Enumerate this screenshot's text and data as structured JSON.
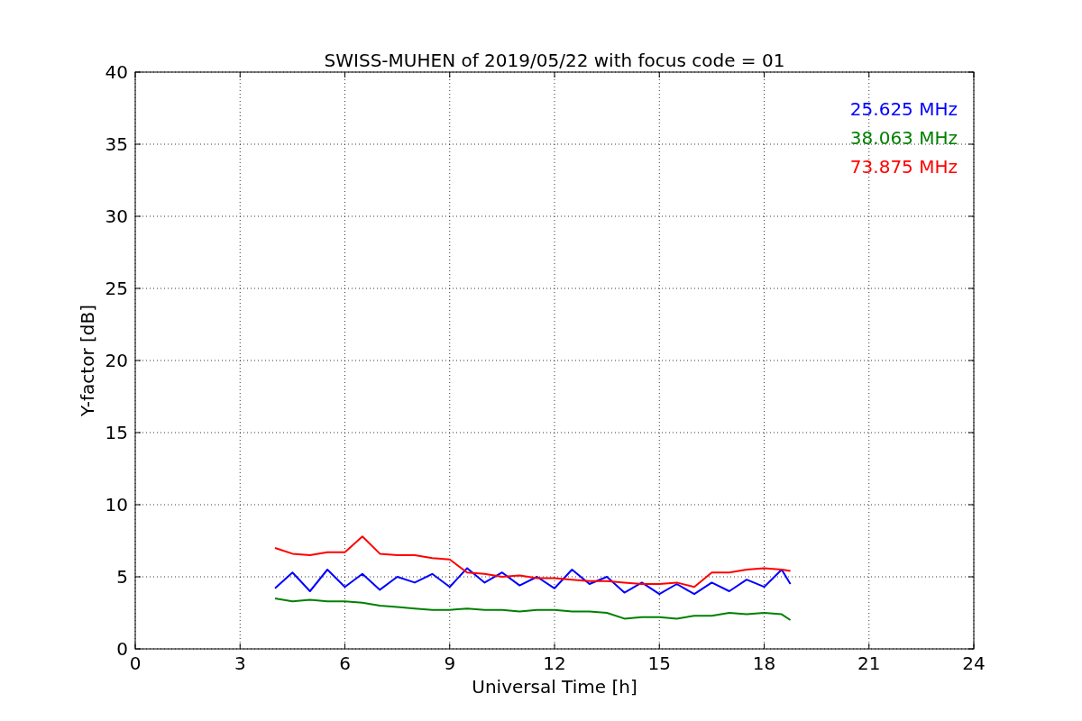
{
  "chart_data": {
    "type": "line",
    "title": "SWISS-MUHEN of 2019/05/22 with focus code = 01",
    "xlabel": "Universal Time [h]",
    "ylabel": "Y-factor [dB]",
    "x": [
      4,
      4.5,
      5,
      5.5,
      6,
      6.5,
      7,
      7.5,
      8,
      8.5,
      9,
      9.5,
      10,
      10.5,
      11,
      11.5,
      12,
      12.5,
      13,
      13.5,
      14,
      14.5,
      15,
      15.5,
      16,
      16.5,
      17,
      17.5,
      18,
      18.5,
      18.75
    ],
    "series": [
      {
        "name": "25.625 MHz",
        "color": "#0000ff",
        "values": [
          4.2,
          5.3,
          4.0,
          5.5,
          4.3,
          5.2,
          4.1,
          5.0,
          4.6,
          5.2,
          4.3,
          5.6,
          4.6,
          5.3,
          4.4,
          5.0,
          4.2,
          5.5,
          4.5,
          5.0,
          3.9,
          4.6,
          3.8,
          4.5,
          3.8,
          4.6,
          4.0,
          4.8,
          4.3,
          5.5,
          4.5
        ]
      },
      {
        "name": "38.063 MHz",
        "color": "#008000",
        "values": [
          3.5,
          3.3,
          3.4,
          3.3,
          3.3,
          3.2,
          3.0,
          2.9,
          2.8,
          2.7,
          2.7,
          2.8,
          2.7,
          2.7,
          2.6,
          2.7,
          2.7,
          2.6,
          2.6,
          2.5,
          2.1,
          2.2,
          2.2,
          2.1,
          2.3,
          2.3,
          2.5,
          2.4,
          2.5,
          2.4,
          2.0
        ]
      },
      {
        "name": "73.875 MHz",
        "color": "#ff0000",
        "values": [
          7.0,
          6.6,
          6.5,
          6.7,
          6.7,
          7.8,
          6.6,
          6.5,
          6.5,
          6.3,
          6.2,
          5.3,
          5.2,
          5.0,
          5.1,
          4.9,
          4.9,
          4.8,
          4.7,
          4.7,
          4.6,
          4.5,
          4.5,
          4.6,
          4.3,
          5.3,
          5.3,
          5.5,
          5.6,
          5.5,
          5.4
        ]
      }
    ],
    "grid": true,
    "xlim": [
      0,
      24
    ],
    "ylim": [
      0,
      40
    ],
    "xticks": [
      0,
      3,
      6,
      9,
      12,
      15,
      18,
      21,
      24
    ],
    "yticks": [
      0,
      5,
      10,
      15,
      20,
      25,
      30,
      35,
      40
    ]
  }
}
